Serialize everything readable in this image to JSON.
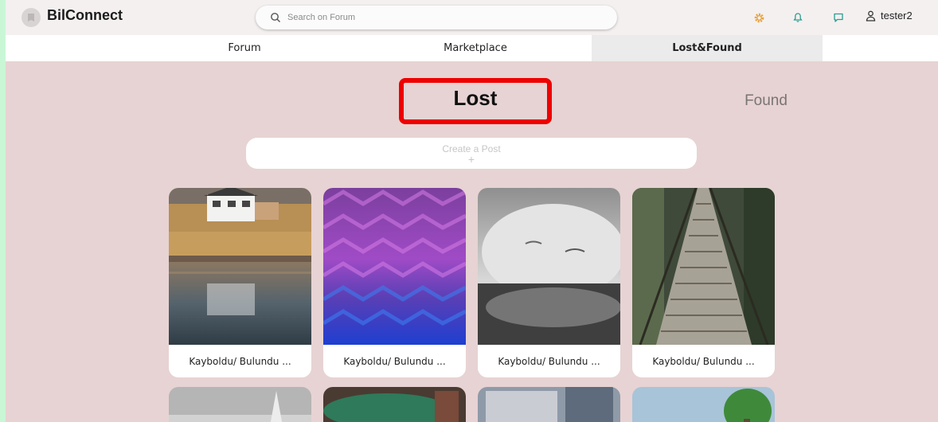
{
  "app": {
    "brand": "BilConnect"
  },
  "search": {
    "placeholder": "Search on Forum"
  },
  "user": {
    "name": "tester2"
  },
  "nav": {
    "tabs": [
      {
        "label": "Forum",
        "active": false
      },
      {
        "label": "Marketplace",
        "active": false
      },
      {
        "label": "Lost&Found",
        "active": true
      }
    ]
  },
  "filter": {
    "lost_label": "Lost",
    "found_label": "Found",
    "selected": "Lost"
  },
  "create_post": {
    "label": "Create a Post",
    "plus": "+"
  },
  "posts": [
    {
      "caption": "Kayboldu/ Bulundu ...",
      "image": "lakeside-house"
    },
    {
      "caption": "Kayboldu/ Bulundu ...",
      "image": "purple-knit-fabric"
    },
    {
      "caption": "Kayboldu/ Bulundu ...",
      "image": "sleeping-cat"
    },
    {
      "caption": "Kayboldu/ Bulundu ...",
      "image": "rope-bridge"
    },
    {
      "caption": "",
      "image": "snowy-tree"
    },
    {
      "caption": "",
      "image": "green-car"
    },
    {
      "caption": "",
      "image": "building"
    },
    {
      "caption": "",
      "image": "tree-sky"
    }
  ],
  "colors": {
    "background": "#e7d3d3",
    "highlight_border": "#ee0000",
    "settings_icon": "#e8a23a",
    "bell_icon": "#2a9d8f",
    "chat_icon": "#2a9d8f"
  }
}
